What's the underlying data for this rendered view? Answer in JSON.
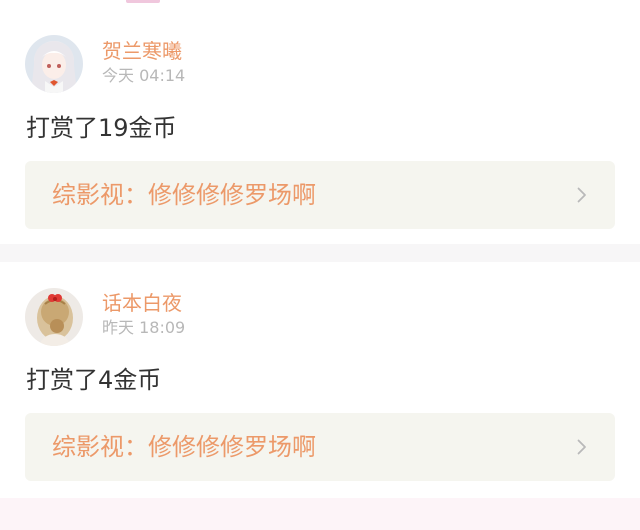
{
  "feed": [
    {
      "user": "贺兰寒曦",
      "time": "今天 04:14",
      "reward": "打赏了19金币",
      "book": "综影视：修修修修罗场啊",
      "avatar_icon": "anime-girl-avatar-icon"
    },
    {
      "user": "话本白夜",
      "time": "昨天 18:09",
      "reward": "打赏了4金币",
      "book": "综影视：修修修修罗场啊",
      "avatar_icon": "hair-bun-avatar-icon"
    }
  ],
  "colors": {
    "accent": "#ec9969",
    "timestamp": "#b8b8b8",
    "card_bg": "#ffffff",
    "link_bg": "#f5f5ef"
  }
}
